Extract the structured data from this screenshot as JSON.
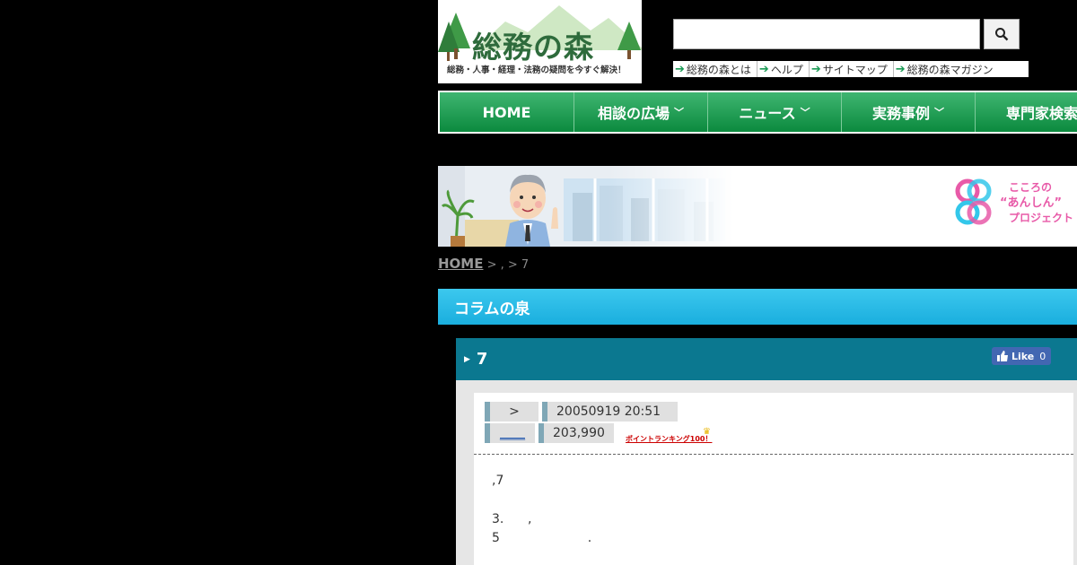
{
  "header": {
    "logo_title": "総務の森",
    "logo_tagline": "総務・人事・経理・法務の疑問を今すぐ解決！"
  },
  "search": {
    "placeholder": "",
    "button_icon": "search-icon"
  },
  "sublinks": [
    {
      "label": "総務の森とは"
    },
    {
      "label": "ヘルプ"
    },
    {
      "label": "サイトマップ"
    },
    {
      "label": "総務の森マガジン"
    }
  ],
  "nav": [
    {
      "label": "HOME"
    },
    {
      "label": "相談の広場"
    },
    {
      "label": "ニュース"
    },
    {
      "label": "実務事例"
    },
    {
      "label": "専門家検索"
    }
  ],
  "banner": {
    "text_line1": "こころの",
    "text_line2": "“あんしん”",
    "text_line3": "プロジェクト"
  },
  "breadcrumb": {
    "home": "HOME",
    "rest": " > , > 7"
  },
  "section": {
    "title": "コラムの泉"
  },
  "post": {
    "title": "7",
    "fb_like_label": "Like",
    "fb_like_count": "0",
    "meta": {
      "category": ">",
      "datetime": "20050919 20:51",
      "author_link": "____",
      "views": "203,990",
      "rank_label": "ポイントランキング100！"
    },
    "body_lines": [
      ",7",
      "3.      ,",
      "5                      ."
    ]
  },
  "colors": {
    "nav_green": "#0b8a3e",
    "section_cyan": "#1aaede",
    "post_head_teal": "#0b7890",
    "facebook_blue": "#4267b2"
  }
}
